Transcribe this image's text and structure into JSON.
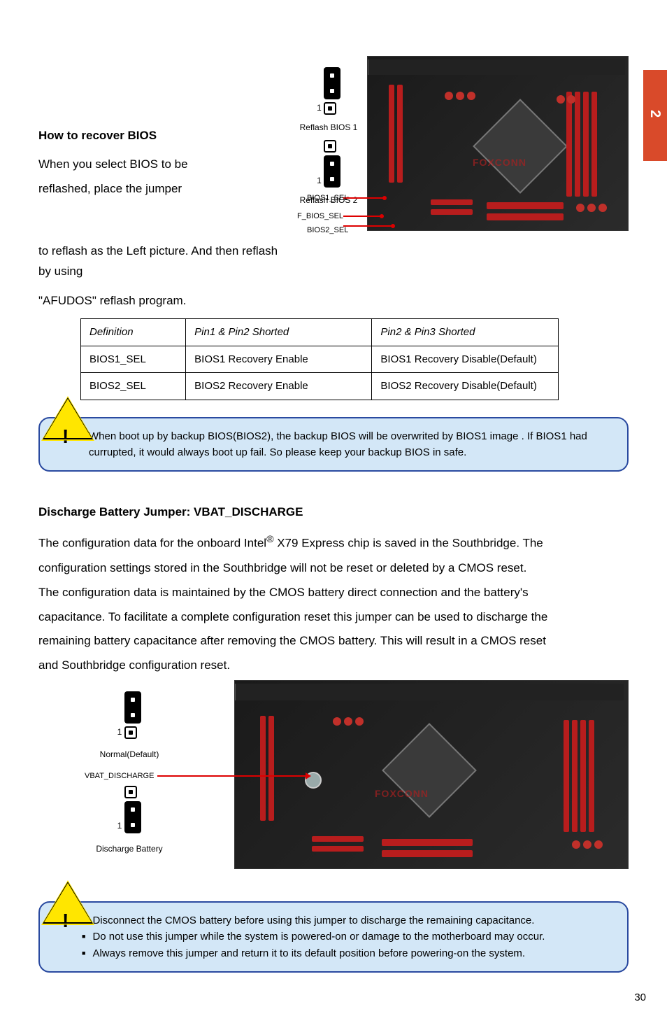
{
  "side_tab": "2",
  "page_number": "30",
  "top": {
    "heading": "How to recover BIOS",
    "line1": "When you select BIOS to be",
    "line2_pre": "reflashed, place the jumper ",
    "line2_post": "to reflash as the Left picture. And then reflash by using ",
    "line3": "\"AFUDOS\" reflash program.",
    "jumper1": {
      "label": "Reflash BIOS 1",
      "pin": "1"
    },
    "jumper2": {
      "label": "Reflash BIOS 2",
      "pin": "1"
    },
    "mobo_labels": {
      "a": "BIOS1_SEL",
      "b": "F_BIOS_SEL",
      "c": "BIOS2_SEL"
    }
  },
  "table": {
    "h1": "Definition",
    "h2": "Pin1 & Pin2 Shorted",
    "h3": "Pin2 & Pin3 Shorted",
    "r1c1": "BIOS1_SEL",
    "r1c2": "BIOS1 Recovery Enable",
    "r1c3": "BIOS1 Recovery Disable(Default)",
    "r2c1": "BIOS2_SEL",
    "r2c2": "BIOS2 Recovery Enable",
    "r2c3": "BIOS2 Recovery Disable(Default)"
  },
  "callout1": "When boot up by backup BIOS(BIOS2), the backup BIOS will be overwrited by BIOS1 image . If BIOS1 had currupted, it would always boot up fail. So please keep your backup BIOS in safe.",
  "sec2": {
    "heading": "Discharge Battery Jumper: VBAT_DISCHARGE",
    "p1a": "The configuration data for the onboard Intel",
    "p1a_sup": "®",
    "p1a_tail": " X79 Express chip is saved in the Southbridge. The ",
    "p1b": "configuration settings stored in the Southbridge will not be reset or deleted by a CMOS reset.",
    "p2a": "The configuration data is maintained by the CMOS battery direct connection and the battery's ",
    "p2b": "capacitance. To facilitate a complete configuration reset this jumper can be used to discharge the ",
    "p2c": "remaining battery capacitance after removing the CMOS battery. This will result in a CMOS reset ",
    "p2d": "and Southbridge configuration reset.",
    "jumper_normal": {
      "label": "Normal(Default)",
      "pin": "1"
    },
    "jumper_discharge": {
      "label": "Discharge Battery",
      "pin": "1"
    },
    "mobo_label": "VBAT_DISCHARGE"
  },
  "callout2": {
    "l1": "Disconnect the CMOS battery before using this jumper to discharge the remaining capacitance.",
    "l2": "Do not use this jumper while the system is powered-on or damage to the motherboard may occur.",
    "l3": "Always remove this jumper and return it to its default position before powering-on the system."
  }
}
